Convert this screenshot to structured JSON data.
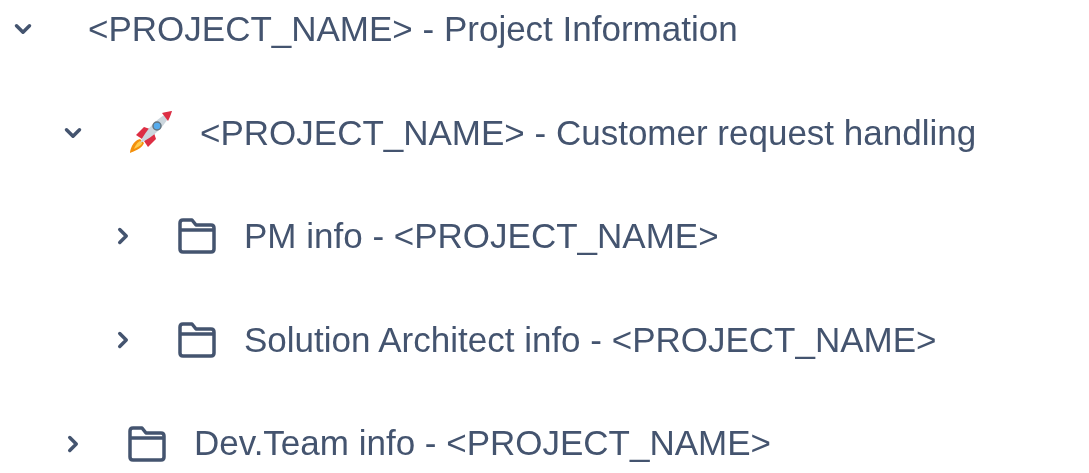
{
  "tree": [
    {
      "label": "<PROJECT_NAME> - Project Information",
      "expanded": true,
      "children": [
        {
          "label": "<PROJECT_NAME> - Customer request handling",
          "kind": "rocket",
          "expanded": true,
          "children": [
            {
              "label": "PM info - <PROJECT_NAME>",
              "kind": "folder",
              "expanded": false
            },
            {
              "label": "Solution Architect info - <PROJECT_NAME>",
              "kind": "folder",
              "expanded": false
            }
          ]
        },
        {
          "label": "Dev.Team info - <PROJECT_NAME>",
          "kind": "folder",
          "expanded": false
        }
      ]
    }
  ]
}
